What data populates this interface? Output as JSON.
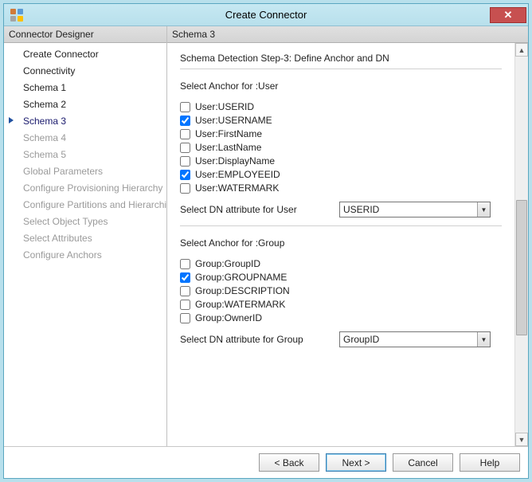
{
  "window": {
    "title": "Create Connector"
  },
  "left": {
    "header": "Connector Designer",
    "items": [
      {
        "label": "Create Connector",
        "state": "completed"
      },
      {
        "label": "Connectivity",
        "state": "completed"
      },
      {
        "label": "Schema 1",
        "state": "completed"
      },
      {
        "label": "Schema 2",
        "state": "completed"
      },
      {
        "label": "Schema 3",
        "state": "current"
      },
      {
        "label": "Schema 4",
        "state": "pending"
      },
      {
        "label": "Schema 5",
        "state": "pending"
      },
      {
        "label": "Global Parameters",
        "state": "pending"
      },
      {
        "label": "Configure Provisioning Hierarchy",
        "state": "pending"
      },
      {
        "label": "Configure Partitions and Hierarchies",
        "state": "pending"
      },
      {
        "label": "Select Object Types",
        "state": "pending"
      },
      {
        "label": "Select Attributes",
        "state": "pending"
      },
      {
        "label": "Configure Anchors",
        "state": "pending"
      }
    ]
  },
  "right": {
    "header": "Schema 3",
    "stepTitle": "Schema Detection Step-3: Define Anchor and DN",
    "user": {
      "sectionLabel": "Select Anchor for :User",
      "checks": [
        {
          "label": "User:USERID",
          "checked": false
        },
        {
          "label": "User:USERNAME",
          "checked": true
        },
        {
          "label": "User:FirstName",
          "checked": false
        },
        {
          "label": "User:LastName",
          "checked": false
        },
        {
          "label": "User:DisplayName",
          "checked": false
        },
        {
          "label": "User:EMPLOYEEID",
          "checked": true
        },
        {
          "label": "User:WATERMARK",
          "checked": false
        }
      ],
      "dnLabel": "Select DN attribute for User",
      "dnValue": "USERID"
    },
    "group": {
      "sectionLabel": "Select Anchor for :Group",
      "checks": [
        {
          "label": "Group:GroupID",
          "checked": false
        },
        {
          "label": "Group:GROUPNAME",
          "checked": true
        },
        {
          "label": "Group:DESCRIPTION",
          "checked": false
        },
        {
          "label": "Group:WATERMARK",
          "checked": false
        },
        {
          "label": "Group:OwnerID",
          "checked": false
        }
      ],
      "dnLabel": "Select DN attribute for Group",
      "dnValue": "GroupID"
    }
  },
  "footer": {
    "back": "<  Back",
    "next": "Next  >",
    "cancel": "Cancel",
    "help": "Help"
  }
}
